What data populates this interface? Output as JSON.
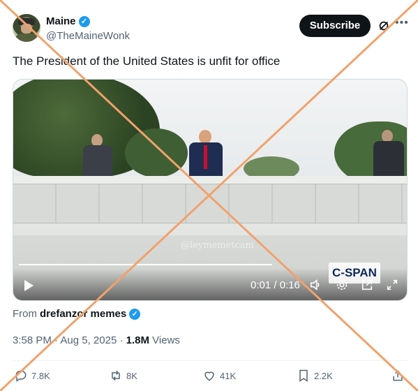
{
  "author": {
    "display_name": "Maine",
    "handle": "@TheMaineWonk"
  },
  "header": {
    "subscribe_label": "Subscribe",
    "more_label": "•••"
  },
  "tweet": {
    "text": "The President of the United States is unfit for office"
  },
  "media": {
    "watermark": "@leymemetcam",
    "network_logo": "C-SPAN",
    "time": "0:01 / 0:16",
    "progress": 0.0625
  },
  "source": {
    "prefix": "From",
    "name": "drefanzor memes"
  },
  "meta": {
    "time": "3:58 PM",
    "separator": "·",
    "date": "Aug 5, 2025",
    "views_count": "1.8M",
    "views_label": "Views"
  },
  "actions": {
    "replies": "7.8K",
    "reposts": "8K",
    "likes": "41K",
    "bookmarks": "2.2K"
  },
  "colors": {
    "accent": "#1d9bf0",
    "text_primary": "#0f1419",
    "text_secondary": "#536471",
    "overlay_cross": "#f0a26b"
  }
}
